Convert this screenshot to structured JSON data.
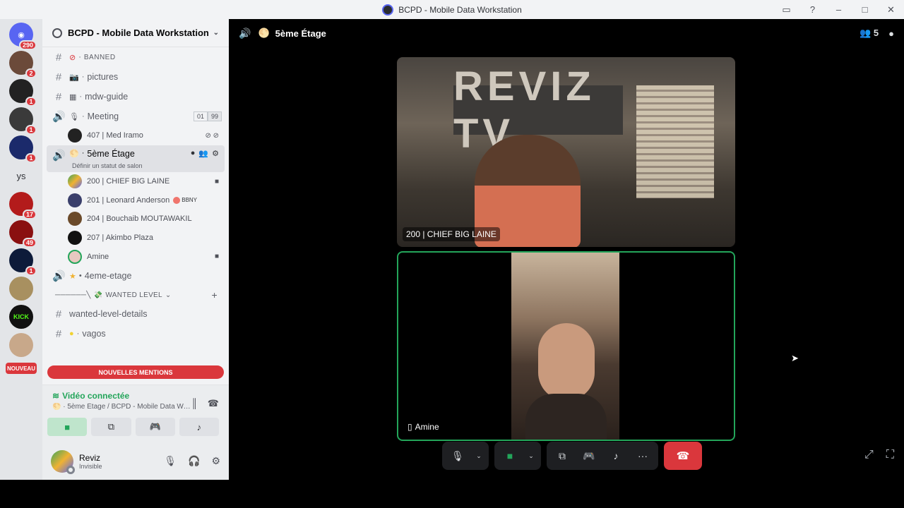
{
  "window": {
    "title": "BCPD - Mobile Data Workstation",
    "controls": [
      "inbox-icon",
      "help-icon",
      "minimize-icon",
      "maximize-icon",
      "close-icon"
    ]
  },
  "servers": {
    "home_badge": "290",
    "items": [
      {
        "badge": "2"
      },
      {
        "badge": "1"
      },
      {
        "badge": "1"
      },
      {
        "badge": "1"
      },
      {
        "text": "ys"
      },
      {
        "badge": "17"
      },
      {
        "badge": "49"
      },
      {
        "badge": "1"
      },
      {
        "badge": ""
      },
      {
        "badge": ""
      },
      {
        "badge": ""
      }
    ],
    "nouveau_label": "NOUVEAU"
  },
  "guild": {
    "name": "BCPD - Mobile Data Workstation"
  },
  "channels": [
    {
      "name": "BANNED",
      "prefix": "·"
    },
    {
      "name": "pictures",
      "prefix": "·"
    },
    {
      "name": "mdw-guide",
      "prefix": "·"
    },
    {
      "name": "Meeting",
      "prefix": "·",
      "count_a": "01",
      "count_b": "99"
    },
    {
      "name": "5ème Étage",
      "prefix": "·",
      "status_hint": "Définir un statut de salon"
    },
    {
      "name": "4eme-etage",
      "prefix": "•"
    }
  ],
  "meeting_members": [
    {
      "name": "407 | Med Iramo"
    }
  ],
  "stage_members": [
    {
      "name": "200 | CHIEF BIG LAINE"
    },
    {
      "name": "201 | Leonard Anderson",
      "tag": "BBNY"
    },
    {
      "name": "204 | Bouchaib MOUTAWAKIL"
    },
    {
      "name": "207 | Akimbo Plaza"
    },
    {
      "name": "Amine"
    }
  ],
  "category": {
    "name": "WANTED LEVEL"
  },
  "lower_channels": [
    {
      "name": "wanted-level-details"
    },
    {
      "name": "vagos",
      "prefix": "·"
    }
  ],
  "mentions_banner": "NOUVELLES MENTIONS",
  "voice": {
    "status": "Vidéo connectée",
    "location": "5ème Étage / BCPD - Mobile Data Wor..."
  },
  "user": {
    "name": "Reviz",
    "status": "Invisible"
  },
  "stage": {
    "title": "5ème Étage",
    "participants_count": "5",
    "tiles": [
      {
        "label": "200 | CHIEF BIG LAINE",
        "wall_text": "REVIZ TV"
      },
      {
        "label": "Amine"
      }
    ]
  },
  "colors": {
    "accent_green": "#23a55a",
    "danger_red": "#da373c",
    "blurple": "#5865f2"
  }
}
